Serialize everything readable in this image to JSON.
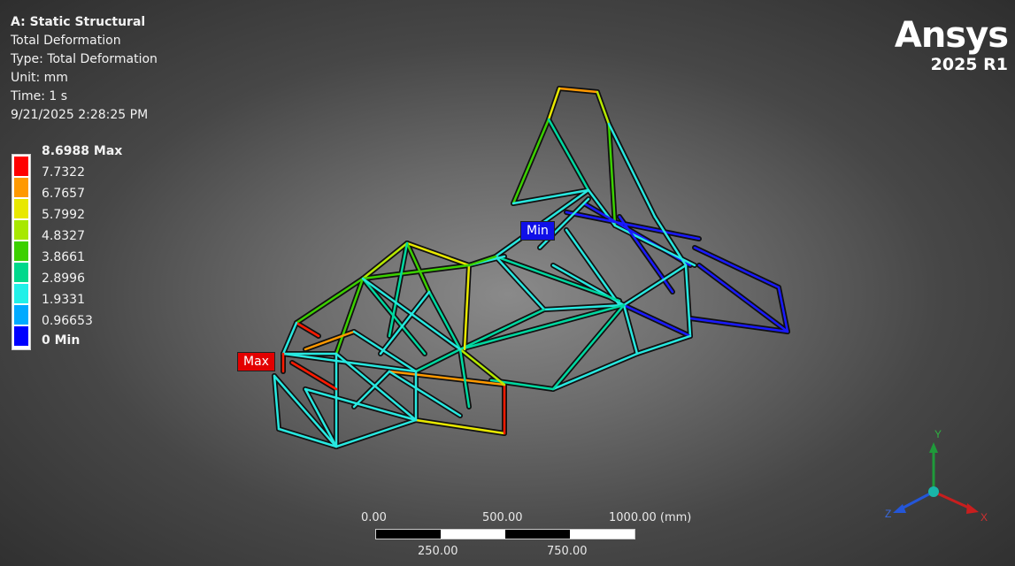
{
  "header": {
    "title": "A: Static Structural",
    "result_name": "Total Deformation",
    "type": "Type: Total Deformation",
    "unit": "Unit: mm",
    "time": "Time: 1 s",
    "date": "9/21/2025 2:28:25 PM"
  },
  "logo": {
    "brand": "Ansys",
    "version": "2025 R1"
  },
  "legend": {
    "labels": [
      "8.6988 Max",
      "7.7322",
      "6.7657",
      "5.7992",
      "4.8327",
      "3.8661",
      "2.8996",
      "1.9331",
      "0.96653",
      "0 Min"
    ],
    "colors": [
      "#ff0000",
      "#ff9900",
      "#e8e800",
      "#a8e800",
      "#3cd000",
      "#00d88c",
      "#22f0e8",
      "#00aaff",
      "#0000ff"
    ]
  },
  "probes": {
    "max_label": "Max",
    "min_label": "Min"
  },
  "scale": {
    "top_labels": [
      "0.00",
      "500.00",
      "1000.00 (mm)"
    ],
    "bottom_labels": [
      "250.00",
      "750.00"
    ]
  },
  "triad": {
    "x": "X",
    "y": "Y",
    "z": "Z"
  }
}
